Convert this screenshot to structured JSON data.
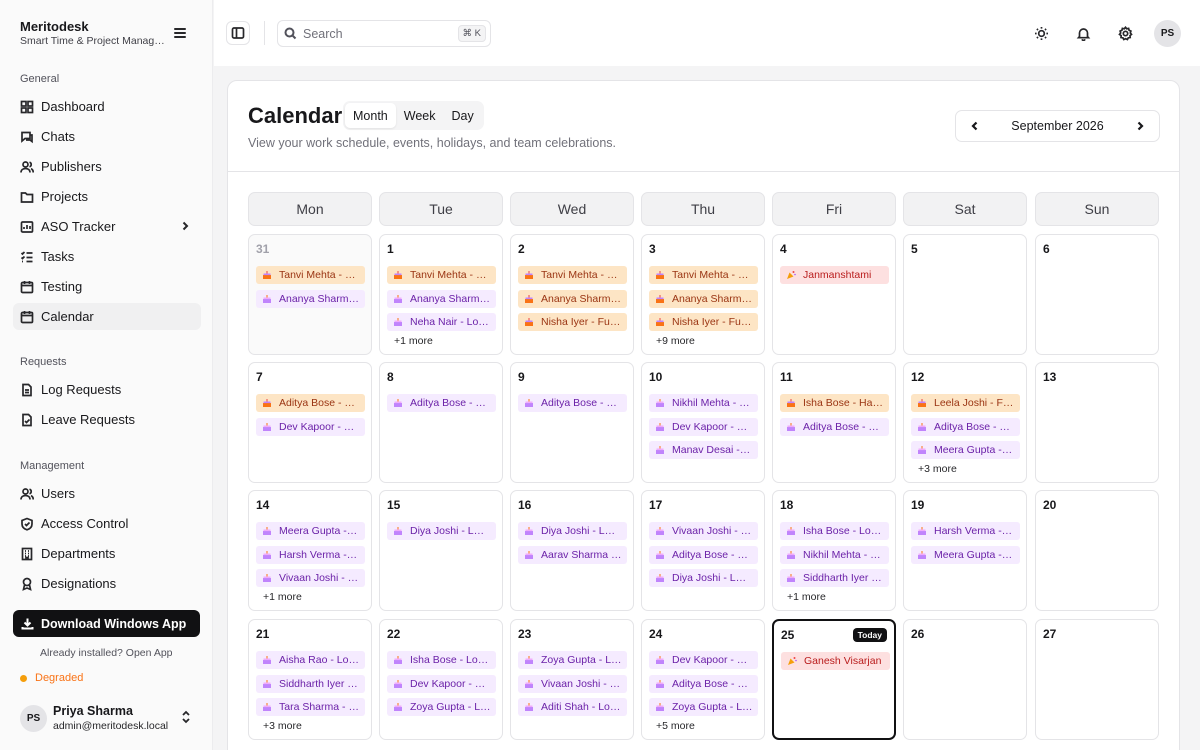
{
  "brand": {
    "name": "Meritodesk",
    "subtitle": "Smart Time & Project Management"
  },
  "sidebar": {
    "sections": [
      {
        "title": "General",
        "items": [
          "Dashboard",
          "Chats",
          "Publishers",
          "Projects",
          "ASO Tracker",
          "Tasks",
          "Testing",
          "Calendar"
        ]
      },
      {
        "title": "Requests",
        "items": [
          "Log Requests",
          "Leave Requests"
        ]
      },
      {
        "title": "Management",
        "items": [
          "Users",
          "Access Control",
          "Departments",
          "Designations"
        ]
      }
    ],
    "active_item": "Calendar",
    "download_label": "Download Windows App",
    "installed_text": "Already installed? Open App",
    "status": {
      "label": "Degraded",
      "color": "#f59e0b"
    },
    "user": {
      "initials": "PS",
      "name": "Priya Sharma",
      "email": "admin@meritodesk.local"
    }
  },
  "topbar": {
    "search_placeholder": "Search",
    "shortcut": "⌘ K",
    "avatar_initials": "PS",
    "icons": [
      "sun-icon",
      "bell-icon",
      "gear-icon"
    ]
  },
  "calendar": {
    "title": "Calendar",
    "subtitle": "View your work schedule, events, holidays, and team celebrations.",
    "views": [
      "Month",
      "Week",
      "Day"
    ],
    "active_view": "Month",
    "month_label": "September 2026",
    "today_label": "Today",
    "weekdays": [
      "Mon",
      "Tue",
      "Wed",
      "Thu",
      "Fri",
      "Sat",
      "Sun"
    ],
    "event_colors": {
      "birthday": "#f5ebff",
      "anniversary": "#fde5c5",
      "holiday": "#fde0e0"
    },
    "weeks": [
      [
        {
          "day": "31",
          "outside": true,
          "events": [
            {
              "type": "anniversary",
              "label": "Tanvi Mehta - …"
            },
            {
              "type": "birthday",
              "label": "Ananya Sharm…"
            }
          ]
        },
        {
          "day": "1",
          "events": [
            {
              "type": "anniversary",
              "label": "Tanvi Mehta - …"
            },
            {
              "type": "birthday",
              "label": "Ananya Sharm…"
            },
            {
              "type": "birthday",
              "label": "Neha Nair - Lo…"
            }
          ],
          "more": "+1 more"
        },
        {
          "day": "2",
          "events": [
            {
              "type": "anniversary",
              "label": "Tanvi Mehta - …"
            },
            {
              "type": "anniversary",
              "label": "Ananya Sharm…"
            },
            {
              "type": "anniversary",
              "label": "Nisha Iyer - Fu…"
            }
          ]
        },
        {
          "day": "3",
          "events": [
            {
              "type": "anniversary",
              "label": "Tanvi Mehta - …"
            },
            {
              "type": "anniversary",
              "label": "Ananya Sharm…"
            },
            {
              "type": "anniversary",
              "label": "Nisha Iyer - Fu…"
            }
          ],
          "more": "+9 more"
        },
        {
          "day": "4",
          "events": [
            {
              "type": "holiday",
              "label": "Janmanshtami"
            }
          ]
        },
        {
          "day": "5",
          "events": []
        },
        {
          "day": "6",
          "events": []
        }
      ],
      [
        {
          "day": "7",
          "events": [
            {
              "type": "anniversary",
              "label": "Aditya Bose - …"
            },
            {
              "type": "birthday",
              "label": "Dev Kapoor - …"
            }
          ]
        },
        {
          "day": "8",
          "events": [
            {
              "type": "birthday",
              "label": "Aditya Bose - …"
            }
          ]
        },
        {
          "day": "9",
          "events": [
            {
              "type": "birthday",
              "label": "Aditya Bose - …"
            }
          ]
        },
        {
          "day": "10",
          "events": [
            {
              "type": "birthday",
              "label": "Nikhil Mehta - …"
            },
            {
              "type": "birthday",
              "label": "Dev Kapoor - …"
            },
            {
              "type": "birthday",
              "label": "Manav Desai -…"
            }
          ]
        },
        {
          "day": "11",
          "events": [
            {
              "type": "anniversary",
              "label": "Isha Bose - Ha…"
            },
            {
              "type": "birthday",
              "label": "Aditya Bose - …"
            }
          ]
        },
        {
          "day": "12",
          "events": [
            {
              "type": "anniversary",
              "label": "Leela Joshi - F…"
            },
            {
              "type": "birthday",
              "label": "Aditya Bose - …"
            },
            {
              "type": "birthday",
              "label": "Meera Gupta -…"
            }
          ],
          "more": "+3 more"
        },
        {
          "day": "13",
          "events": []
        }
      ],
      [
        {
          "day": "14",
          "events": [
            {
              "type": "birthday",
              "label": "Meera Gupta -…"
            },
            {
              "type": "birthday",
              "label": "Harsh Verma -…"
            },
            {
              "type": "birthday",
              "label": "Vivaan Joshi - …"
            }
          ],
          "more": "+1 more"
        },
        {
          "day": "15",
          "events": [
            {
              "type": "birthday",
              "label": "Diya Joshi - L…"
            }
          ]
        },
        {
          "day": "16",
          "events": [
            {
              "type": "birthday",
              "label": "Diya Joshi - L…"
            },
            {
              "type": "birthday",
              "label": "Aarav Sharma …"
            }
          ]
        },
        {
          "day": "17",
          "events": [
            {
              "type": "birthday",
              "label": "Vivaan Joshi - …"
            },
            {
              "type": "birthday",
              "label": "Aditya Bose - …"
            },
            {
              "type": "birthday",
              "label": "Diya Joshi - L…"
            }
          ]
        },
        {
          "day": "18",
          "events": [
            {
              "type": "birthday",
              "label": "Isha Bose - Lo…"
            },
            {
              "type": "birthday",
              "label": "Nikhil Mehta - …"
            },
            {
              "type": "birthday",
              "label": "Siddharth Iyer …"
            }
          ],
          "more": "+1 more"
        },
        {
          "day": "19",
          "events": [
            {
              "type": "birthday",
              "label": "Harsh Verma -…"
            },
            {
              "type": "birthday",
              "label": "Meera Gupta -…"
            }
          ]
        },
        {
          "day": "20",
          "events": []
        }
      ],
      [
        {
          "day": "21",
          "events": [
            {
              "type": "birthday",
              "label": "Aisha Rao - Lo…"
            },
            {
              "type": "birthday",
              "label": "Siddharth Iyer …"
            },
            {
              "type": "birthday",
              "label": "Tara Sharma - …"
            }
          ],
          "more": "+3 more"
        },
        {
          "day": "22",
          "events": [
            {
              "type": "birthday",
              "label": "Isha Bose - Lo…"
            },
            {
              "type": "birthday",
              "label": "Dev Kapoor - …"
            },
            {
              "type": "birthday",
              "label": "Zoya Gupta - L…"
            }
          ]
        },
        {
          "day": "23",
          "events": [
            {
              "type": "birthday",
              "label": "Zoya Gupta - L…"
            },
            {
              "type": "birthday",
              "label": "Vivaan Joshi - …"
            },
            {
              "type": "birthday",
              "label": "Aditi Shah - Lo…"
            }
          ]
        },
        {
          "day": "24",
          "events": [
            {
              "type": "birthday",
              "label": "Dev Kapoor - …"
            },
            {
              "type": "birthday",
              "label": "Aditya Bose - …"
            },
            {
              "type": "birthday",
              "label": "Zoya Gupta - L…"
            }
          ],
          "more": "+5 more"
        },
        {
          "day": "25",
          "today": true,
          "events": [
            {
              "type": "holiday",
              "label": "Ganesh Visarjan"
            }
          ]
        },
        {
          "day": "26",
          "events": []
        },
        {
          "day": "27",
          "events": []
        }
      ]
    ]
  }
}
